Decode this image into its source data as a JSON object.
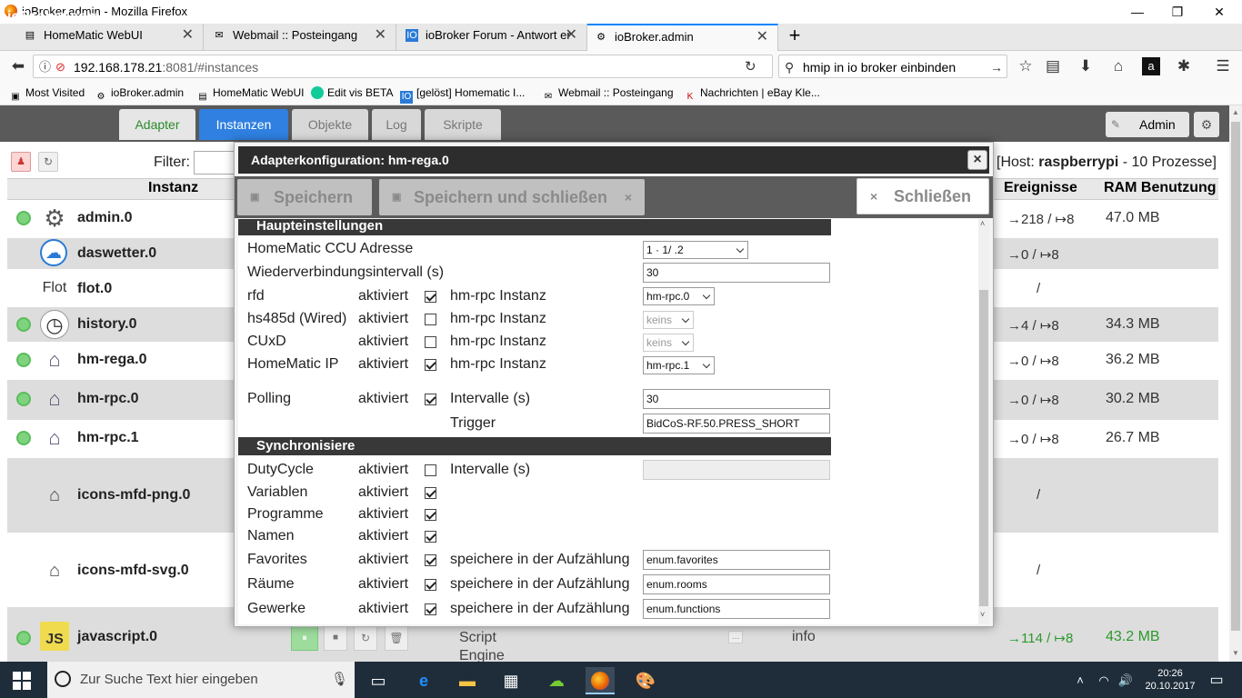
{
  "window": {
    "title": "ioBroker.admin - Mozilla Firefox"
  },
  "tabs": [
    {
      "label": "HomeMatic WebUI"
    },
    {
      "label": "Webmail :: Posteingang"
    },
    {
      "label": "ioBroker Forum - Antwort er"
    },
    {
      "label": "ioBroker.admin"
    }
  ],
  "nav": {
    "url_main": "192.168.178.21",
    "url_rest": ":8081/#instances",
    "search": "hmip in io broker einbinden"
  },
  "bookmarks": [
    "Most Visited",
    "ioBroker.admin",
    "HomeMatic WebUI",
    "Edit vis BETA",
    "[gelöst] Homematic I...",
    "Webmail :: Posteingang",
    "Nachrichten | eBay Kle..."
  ],
  "app": {
    "title": "ioBroker.admin",
    "tabs": [
      "Adapter",
      "Instanzen",
      "Objekte",
      "Log",
      "Skripte"
    ],
    "user": "Admin",
    "filter_label": "Filter:",
    "host_prefix": "[Host: ",
    "host_name": "raspberrypi",
    "host_suffix": " - 10 Prozesse]",
    "col_instance": "Instanz",
    "col_events": "Ereignisse",
    "col_ram": "RAM Benutzung",
    "instances": [
      {
        "name": "admin.0",
        "icon": "⚙",
        "events": "→218 / ↦8",
        "ram": "47.0 MB"
      },
      {
        "name": "daswetter.0",
        "icon": "☁",
        "events": "→0 / ↦8",
        "ram": ""
      },
      {
        "name": "flot.0",
        "icon": "Flot",
        "events": "/",
        "ram": ""
      },
      {
        "name": "history.0",
        "icon": "◷",
        "events": "→4 / ↦8",
        "ram": "34.3 MB"
      },
      {
        "name": "hm-rega.0",
        "icon": "⌂",
        "events": "→0 / ↦8",
        "ram": "36.2 MB"
      },
      {
        "name": "hm-rpc.0",
        "icon": "⌂",
        "events": "→0 / ↦8",
        "ram": "30.2 MB"
      },
      {
        "name": "hm-rpc.1",
        "icon": "⌂",
        "events": "→0 / ↦8",
        "ram": "26.7 MB"
      },
      {
        "name": "icons-mfd-png.0",
        "icon": "⌂",
        "events": "/",
        "ram": ""
      },
      {
        "name": "icons-mfd-svg.0",
        "icon": "⌂",
        "events": "/",
        "ram": ""
      },
      {
        "name": "javascript.0",
        "icon": "JS",
        "events": "→114 / ↦8",
        "ram": "43.2 MB",
        "extra1": "Script",
        "extra2": "Engine",
        "extra3": "info"
      }
    ]
  },
  "modal": {
    "title": "Adapterkonfiguration: hm-rega.0",
    "save": "Speichern",
    "save_close": "Speichern und schließen",
    "close": "Schließen",
    "sections": [
      "Haupteinstellungen",
      "Synchronisiere"
    ],
    "ccu_label": "HomeMatic CCU Adresse",
    "ccu_value": "1  ·  1/  .2",
    "reconnect_label": "Wiederverbindungsintervall (s)",
    "reconnect_value": "30",
    "activated": "aktiviert",
    "rpc_instance": "hm-rpc Instanz",
    "interval": "Intervalle (s)",
    "store_enum": "speichere in der Aufzählung",
    "rfd": {
      "label": "rfd",
      "checked": true,
      "select": "hm-rpc.0"
    },
    "hs485d": {
      "label": "hs485d (Wired)",
      "checked": false,
      "select": "keins"
    },
    "cuxd": {
      "label": "CUxD",
      "checked": false,
      "select": "keins"
    },
    "hmip": {
      "label": "HomeMatic IP",
      "checked": true,
      "select": "hm-rpc.1"
    },
    "polling": {
      "label": "Polling",
      "checked": true,
      "value": "30"
    },
    "trigger": {
      "label": "Trigger",
      "value": "BidCoS-RF.50.PRESS_SHORT"
    },
    "dutycycle": {
      "label": "DutyCycle",
      "checked": false,
      "value": ""
    },
    "variablen": {
      "label": "Variablen",
      "checked": true
    },
    "programme": {
      "label": "Programme",
      "checked": true
    },
    "namen": {
      "label": "Namen",
      "checked": true
    },
    "favorites": {
      "label": "Favorites",
      "checked": true,
      "value": "enum.favorites"
    },
    "raeume": {
      "label": "Räume",
      "checked": true,
      "value": "enum.rooms"
    },
    "gewerke": {
      "label": "Gewerke",
      "checked": true,
      "value": "enum.functions"
    }
  },
  "taskbar": {
    "search": "Zur Suche Text hier eingeben",
    "time": "20:26",
    "date": "20.10.2017"
  }
}
